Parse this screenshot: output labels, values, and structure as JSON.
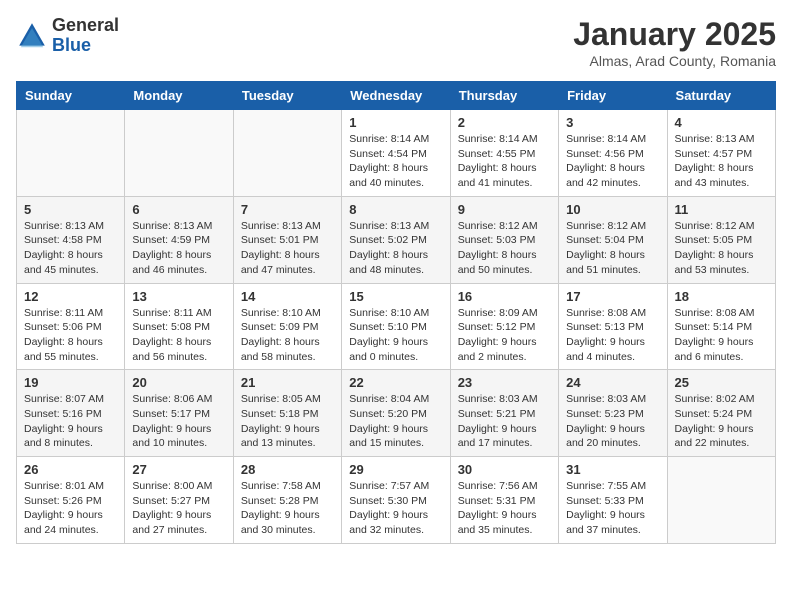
{
  "header": {
    "logo_general": "General",
    "logo_blue": "Blue",
    "month_title": "January 2025",
    "location": "Almas, Arad County, Romania"
  },
  "weekdays": [
    "Sunday",
    "Monday",
    "Tuesday",
    "Wednesday",
    "Thursday",
    "Friday",
    "Saturday"
  ],
  "weeks": [
    [
      {
        "day": "",
        "info": ""
      },
      {
        "day": "",
        "info": ""
      },
      {
        "day": "",
        "info": ""
      },
      {
        "day": "1",
        "info": "Sunrise: 8:14 AM\nSunset: 4:54 PM\nDaylight: 8 hours\nand 40 minutes."
      },
      {
        "day": "2",
        "info": "Sunrise: 8:14 AM\nSunset: 4:55 PM\nDaylight: 8 hours\nand 41 minutes."
      },
      {
        "day": "3",
        "info": "Sunrise: 8:14 AM\nSunset: 4:56 PM\nDaylight: 8 hours\nand 42 minutes."
      },
      {
        "day": "4",
        "info": "Sunrise: 8:13 AM\nSunset: 4:57 PM\nDaylight: 8 hours\nand 43 minutes."
      }
    ],
    [
      {
        "day": "5",
        "info": "Sunrise: 8:13 AM\nSunset: 4:58 PM\nDaylight: 8 hours\nand 45 minutes."
      },
      {
        "day": "6",
        "info": "Sunrise: 8:13 AM\nSunset: 4:59 PM\nDaylight: 8 hours\nand 46 minutes."
      },
      {
        "day": "7",
        "info": "Sunrise: 8:13 AM\nSunset: 5:01 PM\nDaylight: 8 hours\nand 47 minutes."
      },
      {
        "day": "8",
        "info": "Sunrise: 8:13 AM\nSunset: 5:02 PM\nDaylight: 8 hours\nand 48 minutes."
      },
      {
        "day": "9",
        "info": "Sunrise: 8:12 AM\nSunset: 5:03 PM\nDaylight: 8 hours\nand 50 minutes."
      },
      {
        "day": "10",
        "info": "Sunrise: 8:12 AM\nSunset: 5:04 PM\nDaylight: 8 hours\nand 51 minutes."
      },
      {
        "day": "11",
        "info": "Sunrise: 8:12 AM\nSunset: 5:05 PM\nDaylight: 8 hours\nand 53 minutes."
      }
    ],
    [
      {
        "day": "12",
        "info": "Sunrise: 8:11 AM\nSunset: 5:06 PM\nDaylight: 8 hours\nand 55 minutes."
      },
      {
        "day": "13",
        "info": "Sunrise: 8:11 AM\nSunset: 5:08 PM\nDaylight: 8 hours\nand 56 minutes."
      },
      {
        "day": "14",
        "info": "Sunrise: 8:10 AM\nSunset: 5:09 PM\nDaylight: 8 hours\nand 58 minutes."
      },
      {
        "day": "15",
        "info": "Sunrise: 8:10 AM\nSunset: 5:10 PM\nDaylight: 9 hours\nand 0 minutes."
      },
      {
        "day": "16",
        "info": "Sunrise: 8:09 AM\nSunset: 5:12 PM\nDaylight: 9 hours\nand 2 minutes."
      },
      {
        "day": "17",
        "info": "Sunrise: 8:08 AM\nSunset: 5:13 PM\nDaylight: 9 hours\nand 4 minutes."
      },
      {
        "day": "18",
        "info": "Sunrise: 8:08 AM\nSunset: 5:14 PM\nDaylight: 9 hours\nand 6 minutes."
      }
    ],
    [
      {
        "day": "19",
        "info": "Sunrise: 8:07 AM\nSunset: 5:16 PM\nDaylight: 9 hours\nand 8 minutes."
      },
      {
        "day": "20",
        "info": "Sunrise: 8:06 AM\nSunset: 5:17 PM\nDaylight: 9 hours\nand 10 minutes."
      },
      {
        "day": "21",
        "info": "Sunrise: 8:05 AM\nSunset: 5:18 PM\nDaylight: 9 hours\nand 13 minutes."
      },
      {
        "day": "22",
        "info": "Sunrise: 8:04 AM\nSunset: 5:20 PM\nDaylight: 9 hours\nand 15 minutes."
      },
      {
        "day": "23",
        "info": "Sunrise: 8:03 AM\nSunset: 5:21 PM\nDaylight: 9 hours\nand 17 minutes."
      },
      {
        "day": "24",
        "info": "Sunrise: 8:03 AM\nSunset: 5:23 PM\nDaylight: 9 hours\nand 20 minutes."
      },
      {
        "day": "25",
        "info": "Sunrise: 8:02 AM\nSunset: 5:24 PM\nDaylight: 9 hours\nand 22 minutes."
      }
    ],
    [
      {
        "day": "26",
        "info": "Sunrise: 8:01 AM\nSunset: 5:26 PM\nDaylight: 9 hours\nand 24 minutes."
      },
      {
        "day": "27",
        "info": "Sunrise: 8:00 AM\nSunset: 5:27 PM\nDaylight: 9 hours\nand 27 minutes."
      },
      {
        "day": "28",
        "info": "Sunrise: 7:58 AM\nSunset: 5:28 PM\nDaylight: 9 hours\nand 30 minutes."
      },
      {
        "day": "29",
        "info": "Sunrise: 7:57 AM\nSunset: 5:30 PM\nDaylight: 9 hours\nand 32 minutes."
      },
      {
        "day": "30",
        "info": "Sunrise: 7:56 AM\nSunset: 5:31 PM\nDaylight: 9 hours\nand 35 minutes."
      },
      {
        "day": "31",
        "info": "Sunrise: 7:55 AM\nSunset: 5:33 PM\nDaylight: 9 hours\nand 37 minutes."
      },
      {
        "day": "",
        "info": ""
      }
    ]
  ]
}
